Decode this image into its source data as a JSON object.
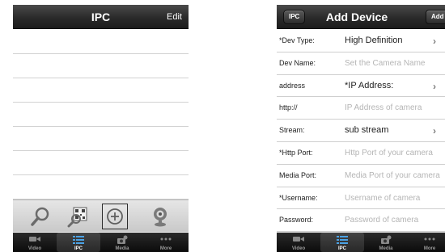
{
  "left_screen": {
    "title": "IPC",
    "edit_label": "Edit",
    "toolbar": {
      "icons": [
        "magnifier-icon",
        "qr-scan-icon",
        "add-circle-icon",
        "webcam-icon"
      ],
      "selected": "add-circle-icon"
    }
  },
  "right_screen": {
    "back_label": "IPC",
    "title": "Add Device",
    "add_label": "Add",
    "fields": [
      {
        "label": "*Dev Type:",
        "value": "High Definition",
        "placeholder": "",
        "chevron": true
      },
      {
        "label": "Dev Name:",
        "value": "",
        "placeholder": "Set the Camera Name",
        "chevron": false
      },
      {
        "label": "address",
        "value": "*IP Address:",
        "placeholder": "",
        "chevron": true
      },
      {
        "label": "http://",
        "value": "",
        "placeholder": "IP Address of camera",
        "chevron": false
      },
      {
        "label": "Stream:",
        "value": "sub stream",
        "placeholder": "",
        "chevron": true
      },
      {
        "label": "*Http Port:",
        "value": "",
        "placeholder": "Http Port of your camera",
        "chevron": false
      },
      {
        "label": "Media Port:",
        "value": "",
        "placeholder": "Media Port of your camera",
        "chevron": false
      },
      {
        "label": "*Username:",
        "value": "",
        "placeholder": "Username of camera",
        "chevron": false
      },
      {
        "label": "Password:",
        "value": "",
        "placeholder": "Password of camera",
        "chevron": false
      }
    ]
  },
  "tabbar": {
    "tabs": [
      "Video",
      "IPC",
      "Media",
      "More"
    ],
    "icons": [
      "video-camera-icon",
      "list-icon",
      "media-icon",
      "more-dots-icon"
    ],
    "active": "IPC"
  },
  "colors": {
    "navbar": "#2a2a2a",
    "toolbar": "#d6d6d6",
    "tabbar": "#111111",
    "placeholder": "#b5b5b5"
  }
}
